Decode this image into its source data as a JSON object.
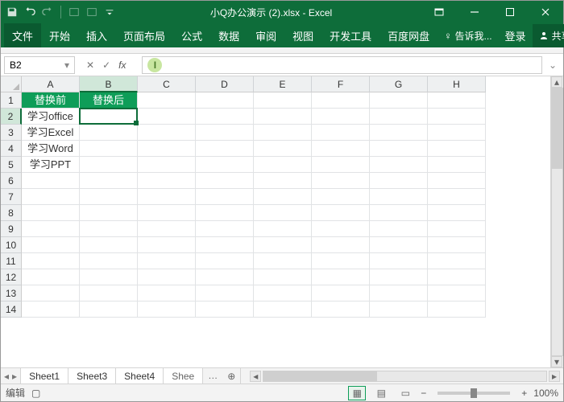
{
  "title": "小Q办公演示 (2).xlsx - Excel",
  "ribbon": {
    "file": "文件",
    "tabs": [
      "开始",
      "插入",
      "页面布局",
      "公式",
      "数据",
      "审阅",
      "视图",
      "开发工具",
      "百度网盘"
    ],
    "tell_me": "告诉我...",
    "login": "登录",
    "share": "共享"
  },
  "namebox": "B2",
  "formula": "",
  "columns": [
    "A",
    "B",
    "C",
    "D",
    "E",
    "F",
    "G",
    "H"
  ],
  "row_count": 14,
  "selected_col_index": 1,
  "selected_row_index": 1,
  "cells": {
    "A1": "替换前",
    "B1": "替换后",
    "A2": "学习office",
    "A3": "学习Excel",
    "A4": "学习Word",
    "A5": "学习PPT"
  },
  "header_cells": [
    "A1",
    "B1"
  ],
  "sheets": [
    "Sheet1",
    "Sheet3",
    "Sheet4"
  ],
  "sheet_trunc": "Shee",
  "status": {
    "mode": "编辑",
    "zoom": "100%"
  }
}
